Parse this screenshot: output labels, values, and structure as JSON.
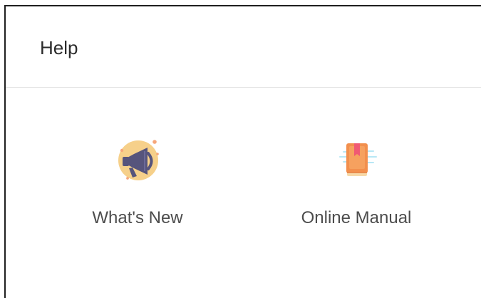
{
  "header": {
    "title": "Help"
  },
  "help_items": [
    {
      "label": "What's New",
      "icon": "megaphone-icon"
    },
    {
      "label": "Online Manual",
      "icon": "manual-book-icon"
    }
  ],
  "colors": {
    "title_text": "#2b2b2b",
    "label_text": "#4d4d4d",
    "divider": "#e3e3e3",
    "whats_new_icon_circle": "#f6d08a",
    "megaphone": "#56547c",
    "manual_book": "#f28f4d",
    "manual_bookmark": "#f05a73",
    "sparkle": "#f6a77a"
  }
}
